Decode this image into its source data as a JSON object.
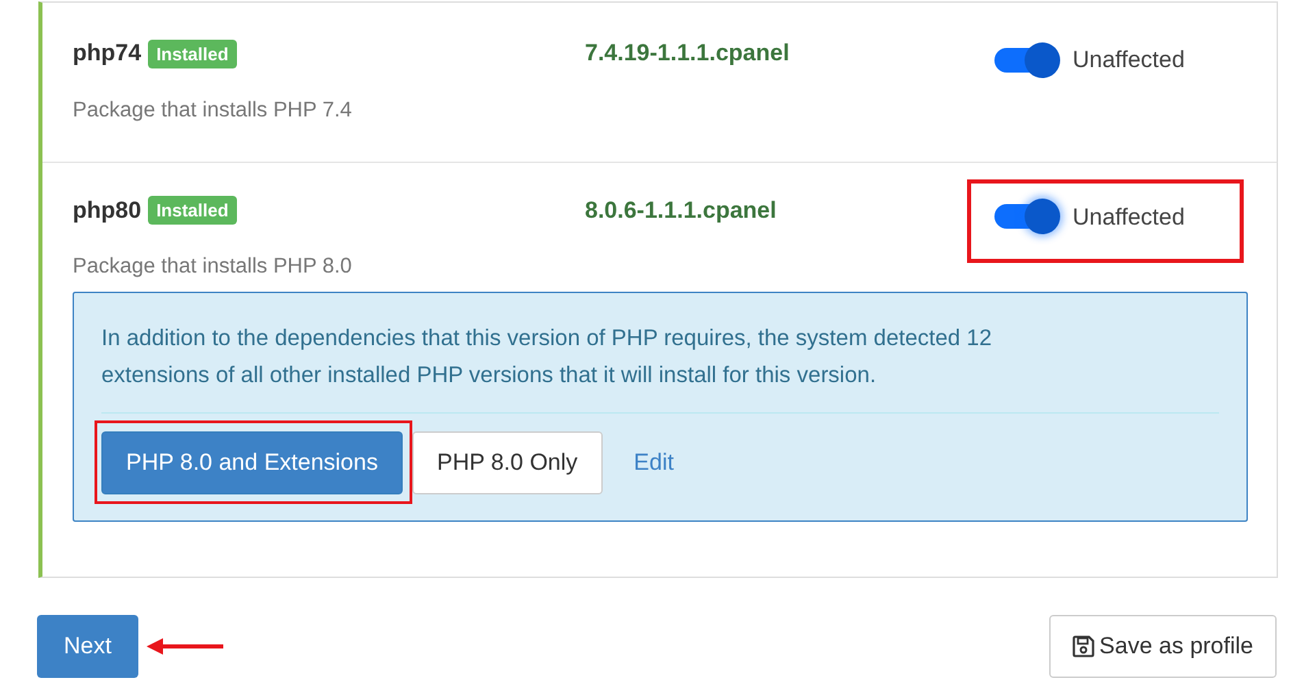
{
  "packages": [
    {
      "name": "php74",
      "badge": "Installed",
      "version": "7.4.19-1.1.1.cpanel",
      "description": "Package that installs PHP 7.4",
      "toggle": {
        "on": true,
        "label": "Unaffected",
        "highlighted": false
      }
    },
    {
      "name": "php80",
      "badge": "Installed",
      "version": "8.0.6-1.1.1.cpanel",
      "description": "Package that installs PHP 8.0",
      "toggle": {
        "on": true,
        "label": "Unaffected",
        "highlighted": true
      },
      "notice": {
        "text": "In addition to the dependencies that this version of PHP requires, the system detected 12 extensions of all other installed PHP versions that it will install for this version.",
        "options": [
          {
            "label": "PHP 8.0 and Extensions",
            "selected": true,
            "highlighted": true
          },
          {
            "label": "PHP 8.0 Only",
            "selected": false,
            "highlighted": false
          }
        ],
        "link": "Edit"
      }
    }
  ],
  "footer": {
    "next": {
      "label": "Next",
      "arrow": true
    },
    "save": {
      "label": "Save as profile"
    }
  }
}
